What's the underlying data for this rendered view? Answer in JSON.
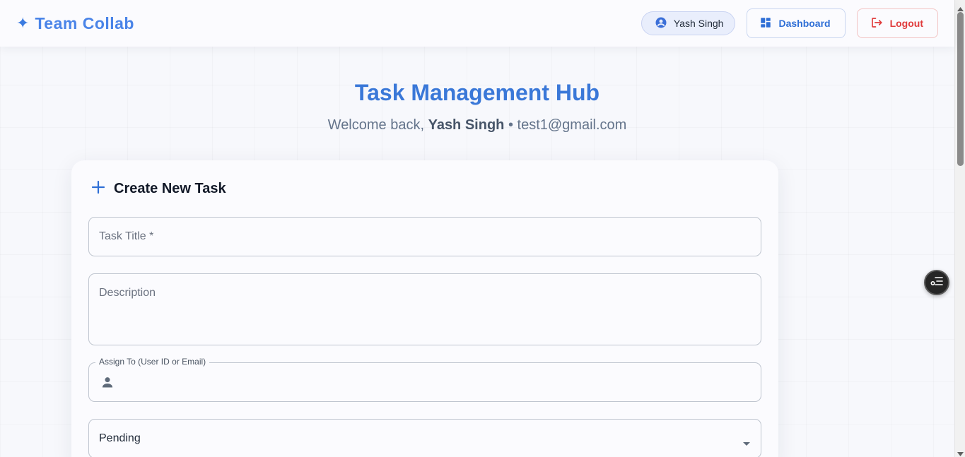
{
  "header": {
    "brand": "Team Collab",
    "user_name": "Yash Singh",
    "dashboard_label": "Dashboard",
    "logout_label": "Logout"
  },
  "hero": {
    "title": "Task Management Hub",
    "welcome_prefix": "Welcome back, ",
    "user_name": "Yash Singh",
    "separator": " • ",
    "email": "test1@gmail.com"
  },
  "form": {
    "heading": "Create New Task",
    "title_placeholder": "Task Title *",
    "description_placeholder": "Description",
    "assign_label": "Assign To (User ID or Email)",
    "assign_value": "",
    "status_value": "Pending"
  },
  "colors": {
    "accent": "#3b7be0",
    "logout": "#e03b3b",
    "background": "#f7f8fc"
  }
}
